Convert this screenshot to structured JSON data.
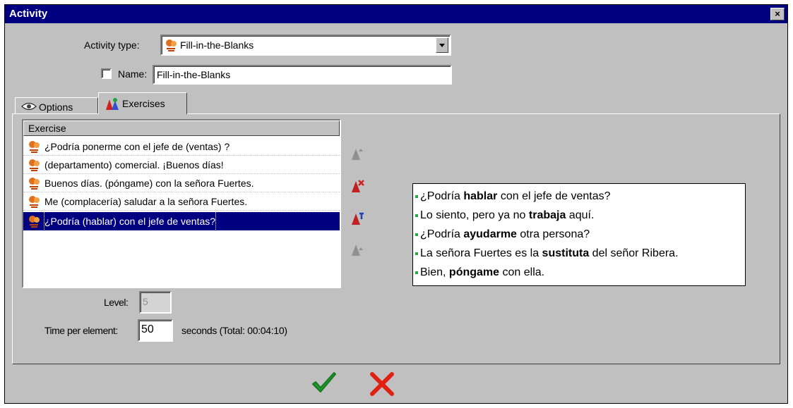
{
  "window": {
    "title": "Activity",
    "close_glyph": "×"
  },
  "activity_type": {
    "label": "Activity type:",
    "value": "Fill-in-the-Blanks"
  },
  "name": {
    "label": "Name:",
    "value": "Fill-in-the-Blanks",
    "checked": false
  },
  "tabs": [
    {
      "label": "Options",
      "icon": "eye-icon",
      "active": false
    },
    {
      "label": "Exercises",
      "icon": "exercises-icon",
      "active": true
    }
  ],
  "exercise_list": {
    "header": "Exercise",
    "rows": [
      {
        "text": "¿Podría ponerme con el jefe de (ventas) ?",
        "selected": false
      },
      {
        "text": "(departamento) comercial. ¡Buenos días!",
        "selected": false
      },
      {
        "text": "Buenos días. (póngame) con la señora Fuertes.",
        "selected": false
      },
      {
        "text": "Me (complacería) saludar a la señora Fuertes.",
        "selected": false
      },
      {
        "text": "¿Podría (hablar) con el jefe de ventas?",
        "selected": true
      }
    ]
  },
  "tools": [
    {
      "icon": "move-up-icon",
      "enabled": false
    },
    {
      "icon": "delete-exercise-icon",
      "enabled": true
    },
    {
      "icon": "edit-exercise-icon",
      "enabled": true
    },
    {
      "icon": "move-down-icon",
      "enabled": false
    }
  ],
  "preview": {
    "lines": [
      {
        "before": "¿Podría ",
        "bold": "hablar",
        "after": " con el jefe de ventas?"
      },
      {
        "before": "Lo siento, pero ya no ",
        "bold": "trabaja",
        "after": " aquí."
      },
      {
        "before": "¿Podría ",
        "bold": "ayudarme",
        "after": " otra persona?"
      },
      {
        "before": "La señora Fuertes es la ",
        "bold": "sustituta",
        "after": " del señor Ribera."
      },
      {
        "before": "Bien, ",
        "bold": "póngame",
        "after": " con ella."
      }
    ],
    "bullet_color": "#22aa44"
  },
  "level": {
    "label": "Level:",
    "value": "5"
  },
  "time": {
    "label": "Time per element:",
    "value": "50",
    "suffix": "seconds (Total: 00:04:10)"
  },
  "footer": {
    "ok_icon": "checkmark-icon",
    "cancel_icon": "cross-icon",
    "ok_color": "#1f9a2e",
    "cancel_color": "#e02010"
  },
  "colors": {
    "titlebar": "#000080",
    "face": "#c0c0c0",
    "selection": "#000080"
  }
}
